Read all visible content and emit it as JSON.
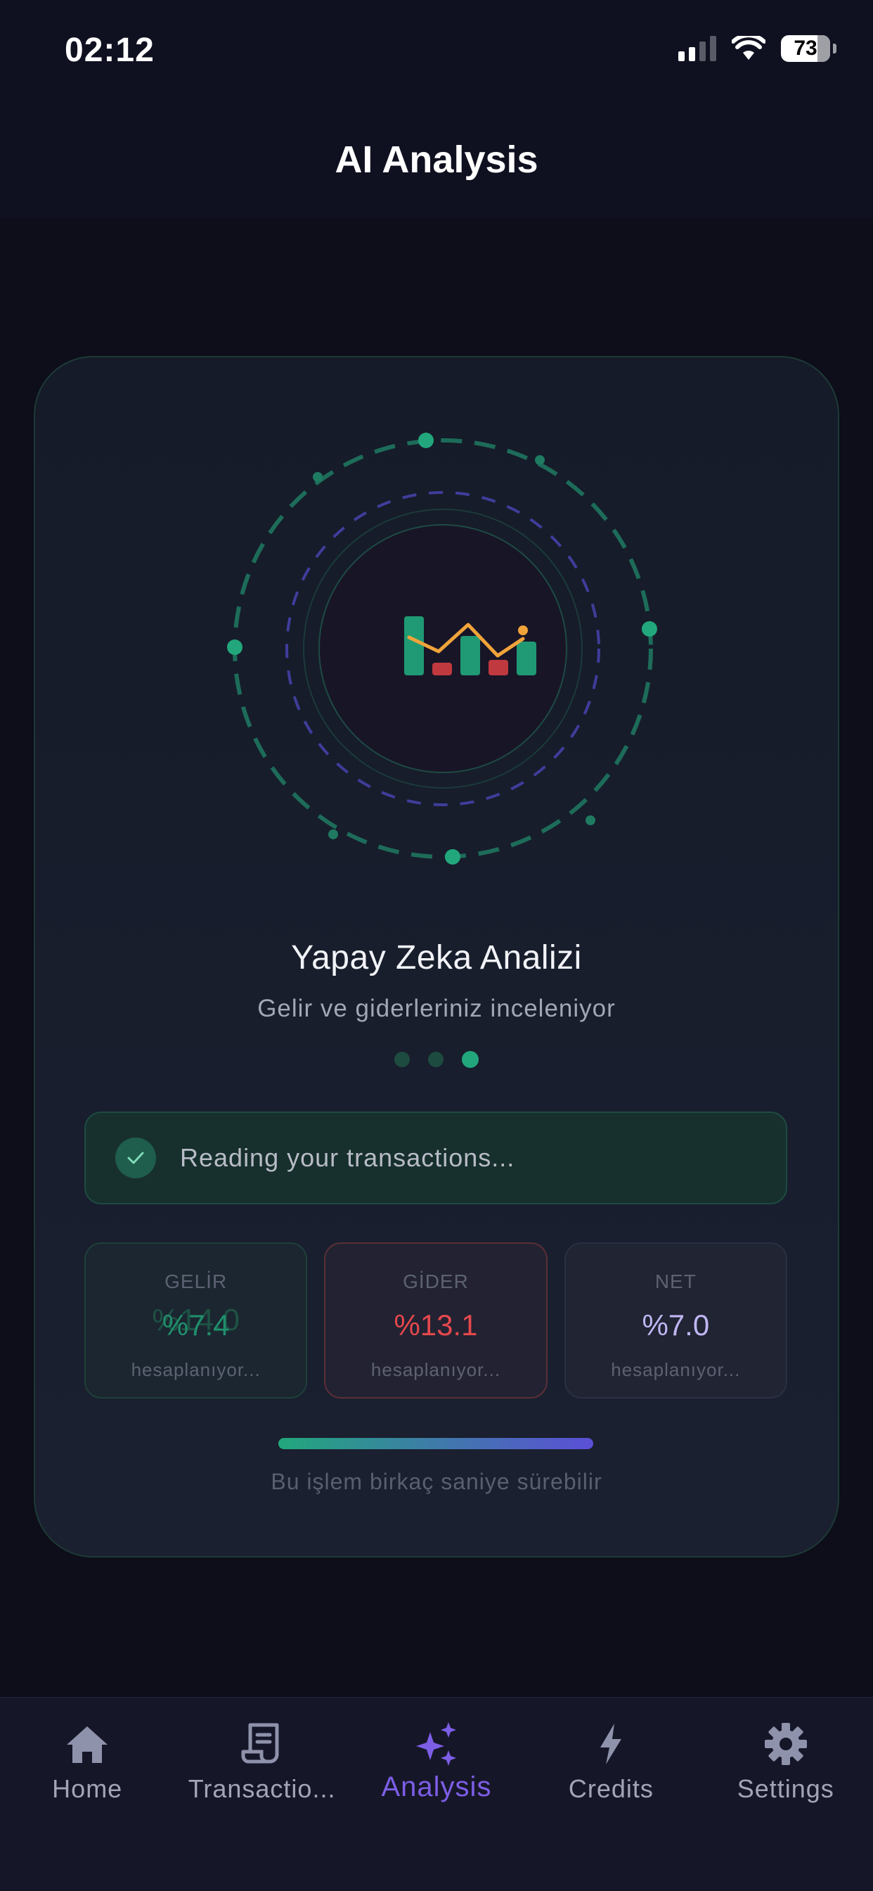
{
  "status": {
    "time": "02:12",
    "battery": "73"
  },
  "header": {
    "title": "AI Analysis"
  },
  "analysis": {
    "title": "Yapay Zeka Analizi",
    "subtitle": "Gelir ve giderleriniz inceleniyor",
    "step": "Reading your transactions...",
    "stats": {
      "income": {
        "label": "GELİR",
        "value": "%7.4",
        "ghost": "%14.0",
        "sub": "hesaplanıyor..."
      },
      "expense": {
        "label": "GİDER",
        "value": "%13.1",
        "sub": "hesaplanıyor..."
      },
      "net": {
        "label": "NET",
        "value": "%7.0",
        "sub": "hesaplanıyor..."
      }
    },
    "note": "Bu işlem birkaç saniye sürebilir"
  },
  "nav": {
    "items": [
      {
        "label": "Home",
        "icon": "home-icon"
      },
      {
        "label": "Transactio...",
        "icon": "receipt-icon"
      },
      {
        "label": "Analysis",
        "icon": "sparkles-icon",
        "active": true
      },
      {
        "label": "Credits",
        "icon": "bolt-icon"
      },
      {
        "label": "Settings",
        "icon": "gear-icon"
      }
    ]
  },
  "colors": {
    "accent_green": "#22a77c",
    "accent_purple": "#7c5ee6",
    "expense_red": "#e5484d"
  }
}
